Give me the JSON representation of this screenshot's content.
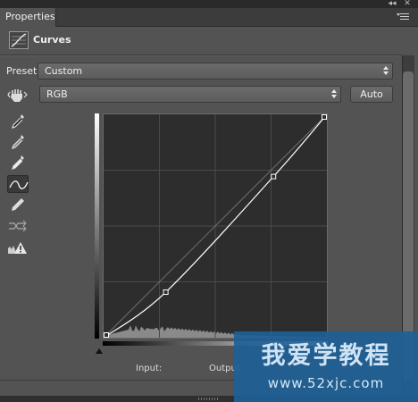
{
  "panel": {
    "tab_label": "Properties",
    "title": "Curves"
  },
  "preset": {
    "label": "Preset:",
    "value": "Custom"
  },
  "channel": {
    "value": "RGB"
  },
  "auto_button": "Auto",
  "tools": [
    {
      "name": "on-image-adjust-icon"
    },
    {
      "name": "sample-black-point-eyedropper-icon"
    },
    {
      "name": "sample-gray-point-eyedropper-icon"
    },
    {
      "name": "sample-white-point-eyedropper-icon"
    },
    {
      "name": "edit-points-curve-icon",
      "active": true
    },
    {
      "name": "draw-curve-pencil-icon"
    },
    {
      "name": "smooth-curve-icon"
    },
    {
      "name": "clipping-warning-icon"
    }
  ],
  "graph": {
    "input_label": "Input:",
    "output_label": "Output:",
    "curve_points": [
      [
        0,
        0
      ],
      [
        71,
        52
      ],
      [
        194,
        184
      ],
      [
        255,
        255
      ]
    ],
    "axis_range": [
      0,
      255
    ],
    "grid_divisions": 4
  },
  "colors": {
    "panel_bg": "#535353",
    "graph_bg": "#2d2d2d",
    "curve": "#ffffff",
    "histogram": "#8a8a8a"
  },
  "watermark": {
    "title": "我爱学教程",
    "url": "www.52xjc.com"
  }
}
